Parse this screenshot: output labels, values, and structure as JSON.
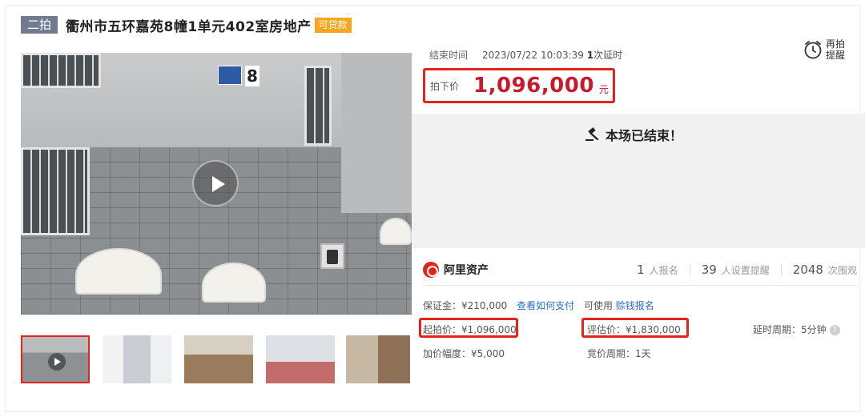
{
  "title": {
    "round_tag": "二拍",
    "lot_name": "衢州市五环嘉苑8幢1单元402室房地产",
    "loan_tag": "可贷款"
  },
  "main_image": {
    "house_number": "8",
    "thumbnails": 5
  },
  "auction": {
    "end_time_label": "结束时间",
    "end_time": "2023/07/22 10:03:39",
    "delay_count": "1",
    "delay_label": "次延时",
    "final_price_label": "拍下价",
    "final_price": "1,096,000",
    "price_unit": "元",
    "ended_message": "本场已结束！",
    "reminder_label": "再拍提醒"
  },
  "brand": {
    "name": "阿里资产"
  },
  "stats": {
    "signups": "1",
    "signups_label": "人报名",
    "reminders": "39",
    "reminders_label": "人设置提醒",
    "views": "2048",
    "views_label": "次围观"
  },
  "details": {
    "deposit": "保证金：¥210,000",
    "how_to_pay": "查看如何支付",
    "usable": "可使用",
    "earn_signup": "赊钱报名",
    "start_price": "起拍价：¥1,096,000",
    "appraisal_price": "评估价：¥1,830,000",
    "delay_period": "延时周期：5分钟",
    "increment": "加价幅度：¥5,000",
    "bid_period": "竞价周期：1天"
  },
  "colors": {
    "accent_red": "#c9192c",
    "highlight_red": "#e5231a",
    "link_blue": "#2b6cc6",
    "loan_orange": "#f7a51d",
    "round_tag_gray": "#6f7b8f"
  }
}
